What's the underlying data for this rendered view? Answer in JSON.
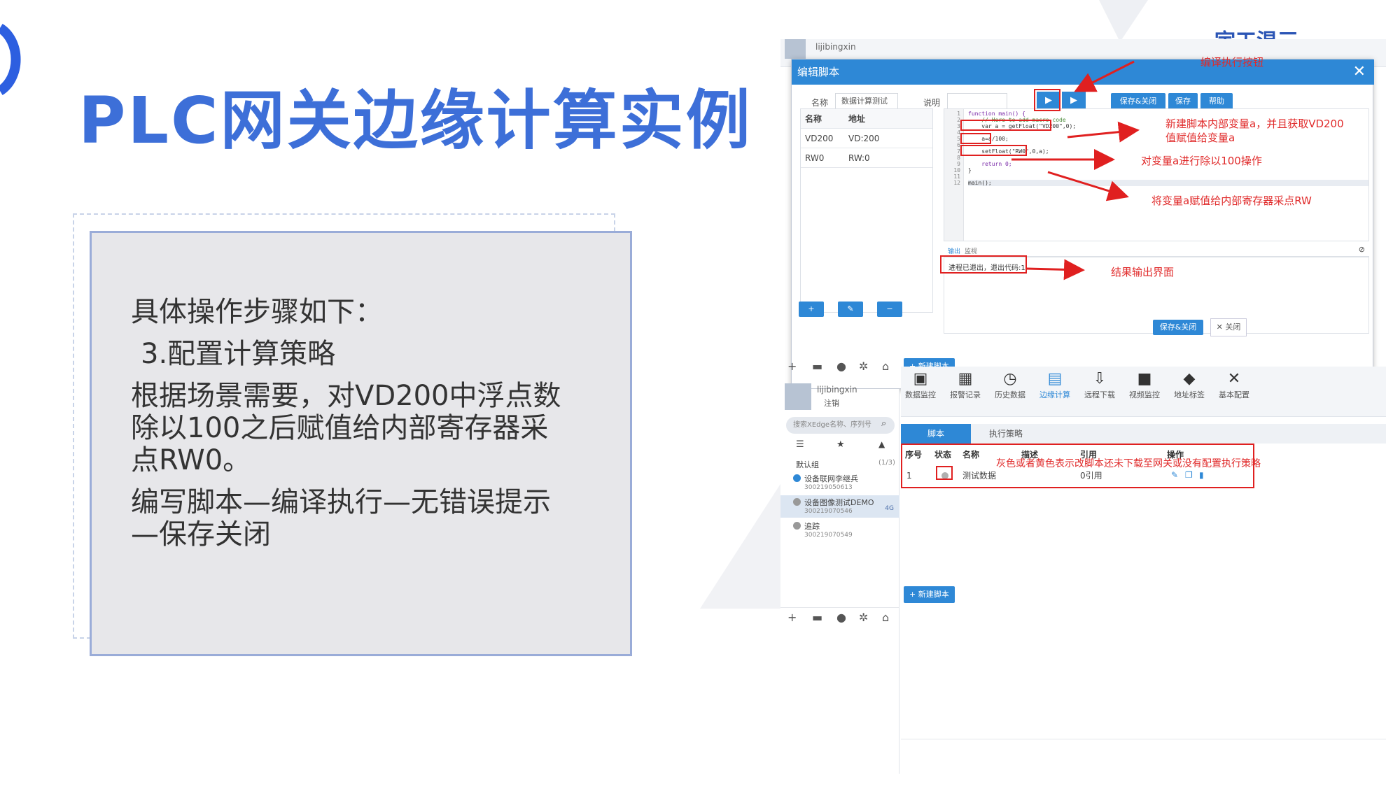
{
  "slide": {
    "title": "PLC网关边缘计算实例",
    "steps_intro": "具体操作步骤如下：",
    "step3": "3.配置计算策略",
    "desc_line1": "根据场景需要，对VD200中浮点数",
    "desc_line2": "除以100之后赋值给内部寄存器采",
    "desc_line3": "点RW0。",
    "flow_line1": "编写脚本—编译执行—无错误提示",
    "flow_line2": "—保存关闭",
    "accent_color": "#3d6fd8"
  },
  "modal": {
    "title": "编辑脚本",
    "close_glyph": "✕",
    "name_label": "名称",
    "name_value": "数据计算测试",
    "desc_label": "说明",
    "save_close": "保存&关闭",
    "save": "保存",
    "help": "帮助",
    "var_headers": [
      "名称",
      "地址"
    ],
    "vars": [
      {
        "name": "VD200",
        "addr": "VD:200"
      },
      {
        "name": "RW0",
        "addr": "RW:0"
      }
    ],
    "add_btn": "+",
    "edit_btn": "✎",
    "del_btn": "−",
    "code_lines": [
      "function main() {",
      "    // Here to add macro code",
      "    var a = getFloat(\"VD200\",0);",
      "",
      "    a=a/100;",
      "",
      "    setFloat(\"RW0\",0,a);",
      "",
      "    return 0;",
      "}",
      "",
      "main();"
    ],
    "line_numbers": [
      "1",
      "2",
      "3",
      "4",
      "5",
      "6",
      "7",
      "8",
      "9",
      "10",
      "11",
      "12"
    ],
    "output_tab": "输出",
    "monitor_tab": "监视",
    "output_text": "进程已退出，退出代码:1",
    "footer_save_close": "保存&关闭",
    "footer_close": "✕ 关闭"
  },
  "annotations": {
    "compile": "编译执行按钮",
    "new_var_1": "新建脚本内部变量a，并且获取VD200",
    "new_var_2": "值赋值给变量a",
    "divide": "对变量a进行除以100操作",
    "assign": "将变量a赋值给内部寄存器采点RW",
    "result": "结果输出界面",
    "status_note": "灰色或者黄色表示改脚本还未下载至网关或没有配置执行策略"
  },
  "app": {
    "user": "lijibingxin",
    "logout": "注销",
    "search_placeholder": "搜索XEdge名称、序列号",
    "group": "默认组",
    "group_count": "(1/3)",
    "devices": [
      {
        "name": "设备联网李继兵",
        "sn": "300219050613",
        "status_color": "#2e88d6",
        "tag": ""
      },
      {
        "name": "设备图像测试DEMO",
        "sn": "300219070546",
        "status_color": "#999999",
        "tag": "4G"
      },
      {
        "name": "追踪",
        "sn": "300219070549",
        "status_color": "#999999",
        "tag": ""
      }
    ],
    "toolbar": [
      {
        "icon": "▣",
        "label": "数据监控"
      },
      {
        "icon": "▦",
        "label": "报警记录"
      },
      {
        "icon": "◷",
        "label": "历史数据"
      },
      {
        "icon": "▤",
        "label": "边缘计算"
      },
      {
        "icon": "⇩",
        "label": "远程下载"
      },
      {
        "icon": "■",
        "label": "视频监控"
      },
      {
        "icon": "◆",
        "label": "地址标签"
      },
      {
        "icon": "✕",
        "label": "基本配置"
      }
    ],
    "tab_script": "脚本",
    "tab_policy": "执行策略",
    "table_headers": [
      "序号",
      "状态",
      "名称",
      "描述",
      "引用",
      "操作"
    ],
    "row": {
      "index": "1",
      "name": "测试数据",
      "desc": "",
      "ref": "0引用"
    },
    "new_script": "+ 新建脚本",
    "brand": "宇工温三"
  }
}
